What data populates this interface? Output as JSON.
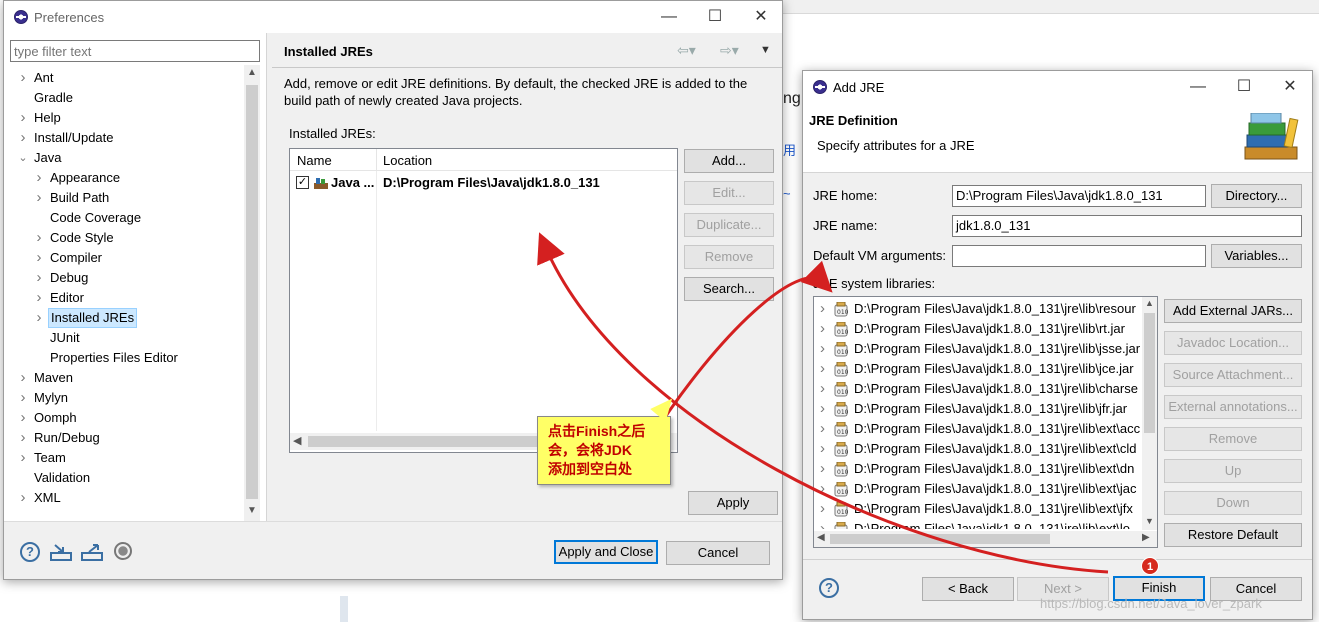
{
  "background": {
    "frag1": "ng",
    "frag2": "用",
    "frag3": "~",
    "watermark": "https://blog.csdn.net/Java_lover_zpark"
  },
  "prefs": {
    "title": "Preferences",
    "filter_placeholder": "type filter text",
    "tree": [
      {
        "label": "Ant",
        "level": 0,
        "expander": "collapsed"
      },
      {
        "label": "Gradle",
        "level": 0,
        "expander": "none"
      },
      {
        "label": "Help",
        "level": 0,
        "expander": "collapsed"
      },
      {
        "label": "Install/Update",
        "level": 0,
        "expander": "collapsed"
      },
      {
        "label": "Java",
        "level": 0,
        "expander": "expanded"
      },
      {
        "label": "Appearance",
        "level": 1,
        "expander": "collapsed"
      },
      {
        "label": "Build Path",
        "level": 1,
        "expander": "collapsed"
      },
      {
        "label": "Code Coverage",
        "level": 1,
        "expander": "none"
      },
      {
        "label": "Code Style",
        "level": 1,
        "expander": "collapsed"
      },
      {
        "label": "Compiler",
        "level": 1,
        "expander": "collapsed"
      },
      {
        "label": "Debug",
        "level": 1,
        "expander": "collapsed"
      },
      {
        "label": "Editor",
        "level": 1,
        "expander": "collapsed"
      },
      {
        "label": "Installed JREs",
        "level": 1,
        "expander": "collapsed",
        "selected": true
      },
      {
        "label": "JUnit",
        "level": 1,
        "expander": "none"
      },
      {
        "label": "Properties Files Editor",
        "level": 1,
        "expander": "none"
      },
      {
        "label": "Maven",
        "level": 0,
        "expander": "collapsed"
      },
      {
        "label": "Mylyn",
        "level": 0,
        "expander": "collapsed"
      },
      {
        "label": "Oomph",
        "level": 0,
        "expander": "collapsed"
      },
      {
        "label": "Run/Debug",
        "level": 0,
        "expander": "collapsed"
      },
      {
        "label": "Team",
        "level": 0,
        "expander": "collapsed"
      },
      {
        "label": "Validation",
        "level": 0,
        "expander": "none"
      },
      {
        "label": "XML",
        "level": 0,
        "expander": "collapsed"
      }
    ],
    "page_title": "Installed JREs",
    "description": "Add, remove or edit JRE definitions. By default, the checked JRE is added to the build path of newly created Java projects.",
    "installed_label": "Installed JREs:",
    "columns": {
      "name": "Name",
      "location": "Location"
    },
    "rows": [
      {
        "name": "Java ...",
        "location": "D:\\Program Files\\Java\\jdk1.8.0_131",
        "checked": true
      }
    ],
    "buttons": {
      "add": "Add...",
      "edit": "Edit...",
      "duplicate": "Duplicate...",
      "remove": "Remove",
      "search": "Search...",
      "apply": "Apply",
      "apply_close": "Apply and Close",
      "cancel": "Cancel"
    }
  },
  "callout": {
    "line1": "点击Finish之后",
    "line2": "会，会将JDK",
    "line3": "添加到空白处"
  },
  "badge": "1",
  "addjre": {
    "title": "Add JRE",
    "header_title": "JRE Definition",
    "header_sub": "Specify attributes for a JRE",
    "home_label": "JRE home:",
    "home_value": "D:\\Program Files\\Java\\jdk1.8.0_131",
    "directory_btn": "Directory...",
    "name_label": "JRE name:",
    "name_value": "jdk1.8.0_131",
    "vm_label": "Default VM arguments:",
    "vm_value": "",
    "variables_btn": "Variables...",
    "libs_label": "JRE system libraries:",
    "libs": [
      "D:\\Program Files\\Java\\jdk1.8.0_131\\jre\\lib\\resour",
      "D:\\Program Files\\Java\\jdk1.8.0_131\\jre\\lib\\rt.jar",
      "D:\\Program Files\\Java\\jdk1.8.0_131\\jre\\lib\\jsse.jar",
      "D:\\Program Files\\Java\\jdk1.8.0_131\\jre\\lib\\jce.jar",
      "D:\\Program Files\\Java\\jdk1.8.0_131\\jre\\lib\\charse",
      "D:\\Program Files\\Java\\jdk1.8.0_131\\jre\\lib\\jfr.jar",
      "D:\\Program Files\\Java\\jdk1.8.0_131\\jre\\lib\\ext\\acc",
      "D:\\Program Files\\Java\\jdk1.8.0_131\\jre\\lib\\ext\\cld",
      "D:\\Program Files\\Java\\jdk1.8.0_131\\jre\\lib\\ext\\dn",
      "D:\\Program Files\\Java\\jdk1.8.0_131\\jre\\lib\\ext\\jac",
      "D:\\Program Files\\Java\\jdk1.8.0_131\\jre\\lib\\ext\\jfx",
      "D:\\Program Files\\Java\\jdk1.8.0_131\\jre\\lib\\ext\\lo"
    ],
    "lib_buttons": {
      "add_external": "Add External JARs...",
      "javadoc": "Javadoc Location...",
      "source": "Source Attachment...",
      "external_ann": "External annotations...",
      "remove": "Remove",
      "up": "Up",
      "down": "Down",
      "restore": "Restore Default"
    },
    "back": "< Back",
    "next": "Next >",
    "finish": "Finish",
    "cancel": "Cancel"
  },
  "colors": {
    "selection": "#cce8ff",
    "arrow": "#d42020",
    "accent": "#0078d7"
  }
}
